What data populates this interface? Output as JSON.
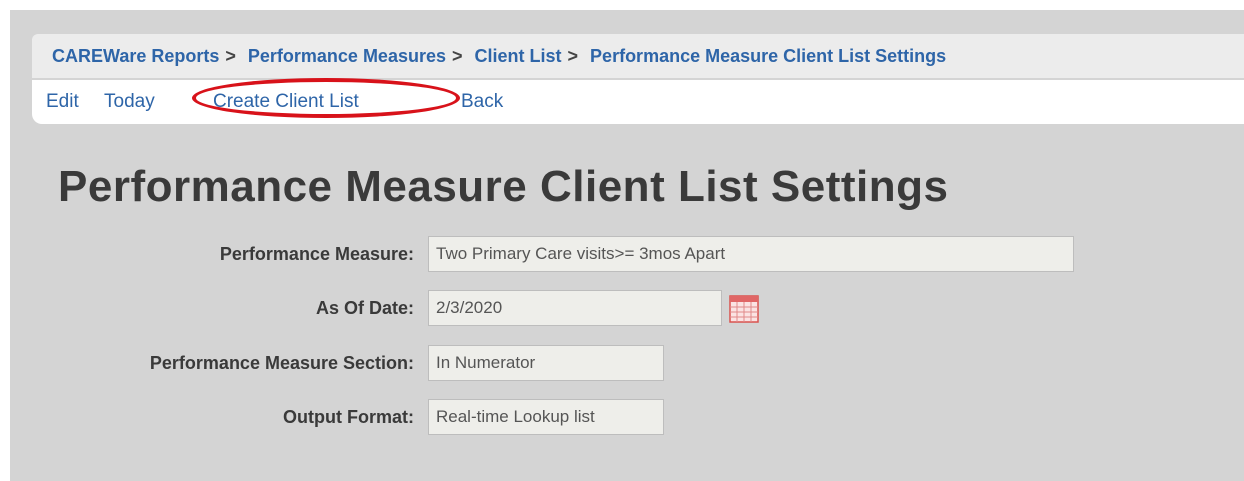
{
  "breadcrumb": {
    "items": [
      {
        "label": "CAREWare Reports"
      },
      {
        "label": "Performance Measures"
      },
      {
        "label": "Client List"
      },
      {
        "label": "Performance Measure Client List Settings"
      }
    ],
    "separator": ">"
  },
  "toolbar": {
    "edit": "Edit",
    "today": "Today",
    "create_client_list": "Create Client List",
    "back": "Back",
    "highlight_color": "#d8121a"
  },
  "page_title": "Performance Measure Client List Settings",
  "form": {
    "performance_measure": {
      "label": "Performance Measure:",
      "value": "Two Primary Care visits>= 3mos Apart"
    },
    "as_of_date": {
      "label": "As Of Date:",
      "value": "2/3/2020",
      "icon": "calendar-icon"
    },
    "section": {
      "label": "Performance Measure Section:",
      "value": "In Numerator"
    },
    "output_format": {
      "label": "Output Format:",
      "value": "Real-time Lookup list"
    }
  },
  "colors": {
    "link": "#2e65a8",
    "page_background": "#d4d4d4",
    "field_background": "#eeeeea"
  }
}
